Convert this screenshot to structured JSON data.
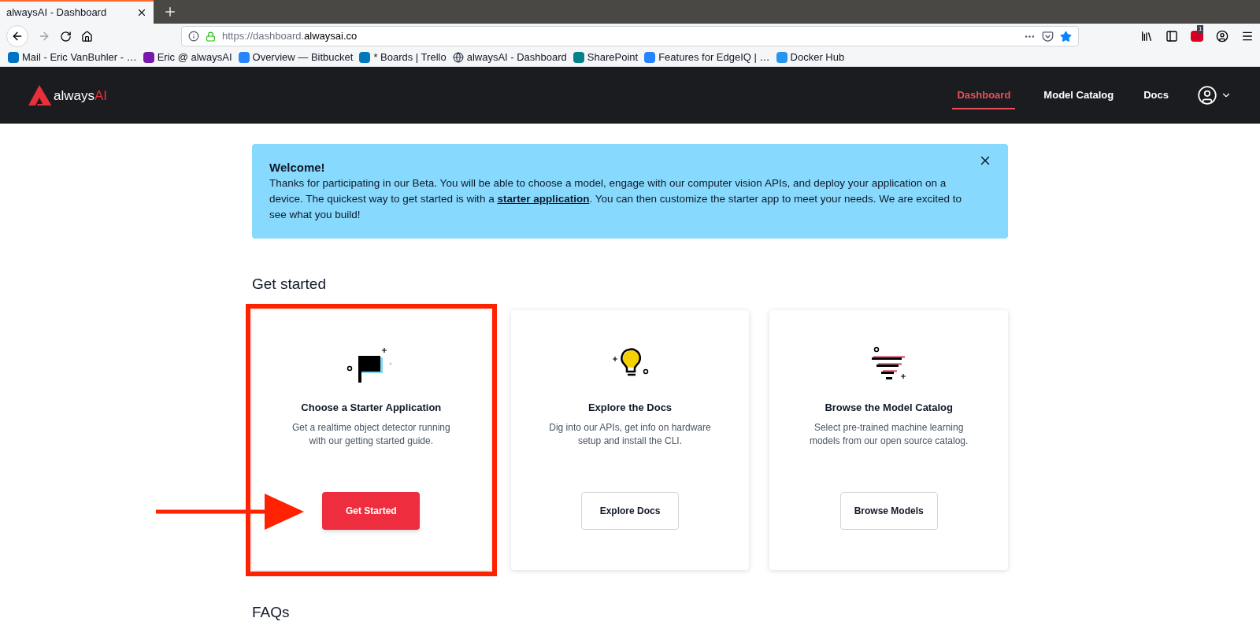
{
  "browser": {
    "tab": {
      "title": "alwaysAI - Dashboard"
    },
    "url": {
      "scheme": "https://dashboard.",
      "domain": "alwaysai.co"
    },
    "extension_badge": "1",
    "bookmarks": [
      {
        "label": "Mail - Eric VanBuhler - …",
        "kind": "mail"
      },
      {
        "label": "Eric @ alwaysAI",
        "kind": "note"
      },
      {
        "label": "Overview — Bitbucket",
        "kind": "bucket"
      },
      {
        "label": "* Boards | Trello",
        "kind": "board"
      },
      {
        "label": "alwaysAI - Dashboard",
        "kind": "globe"
      },
      {
        "label": "SharePoint",
        "kind": "share"
      },
      {
        "label": "Features for EdgeIQ | …",
        "kind": "issue"
      },
      {
        "label": "Docker Hub",
        "kind": "whale"
      }
    ]
  },
  "app": {
    "logo": {
      "first": "always",
      "second": "AI"
    },
    "nav": [
      {
        "label": "Dashboard",
        "selected": true
      },
      {
        "label": "Model Catalog",
        "selected": false
      },
      {
        "label": "Docs",
        "selected": false
      }
    ]
  },
  "banner": {
    "title": "Welcome!",
    "text": "Thanks for participating in our Beta. You will be able to choose a model, engage with our computer vision APIs, and deploy your application on a device. The quickest way to get started is with a **starter application**. You can then customize the starter app to meet your needs. We are excited to see what you build!"
  },
  "get_started": {
    "heading": "Get started",
    "cards": [
      {
        "kind": "flag",
        "title": "Choose a Starter Application",
        "text": "Get a realtime object detector running with our getting started guide.",
        "button": "Get Started",
        "primary": true,
        "highlighted": true
      },
      {
        "kind": "bulb",
        "title": "Explore the Docs",
        "text": "Dig into our APIs, get info on hardware setup and install the CLI.",
        "button": "Explore Docs",
        "primary": false,
        "highlighted": false
      },
      {
        "kind": "filter",
        "title": "Browse the Model Catalog",
        "text": "Select pre-trained machine learning models from our open source catalog.",
        "button": "Browse Models",
        "primary": false,
        "highlighted": false
      }
    ]
  },
  "faqs": {
    "heading": "FAQs"
  }
}
